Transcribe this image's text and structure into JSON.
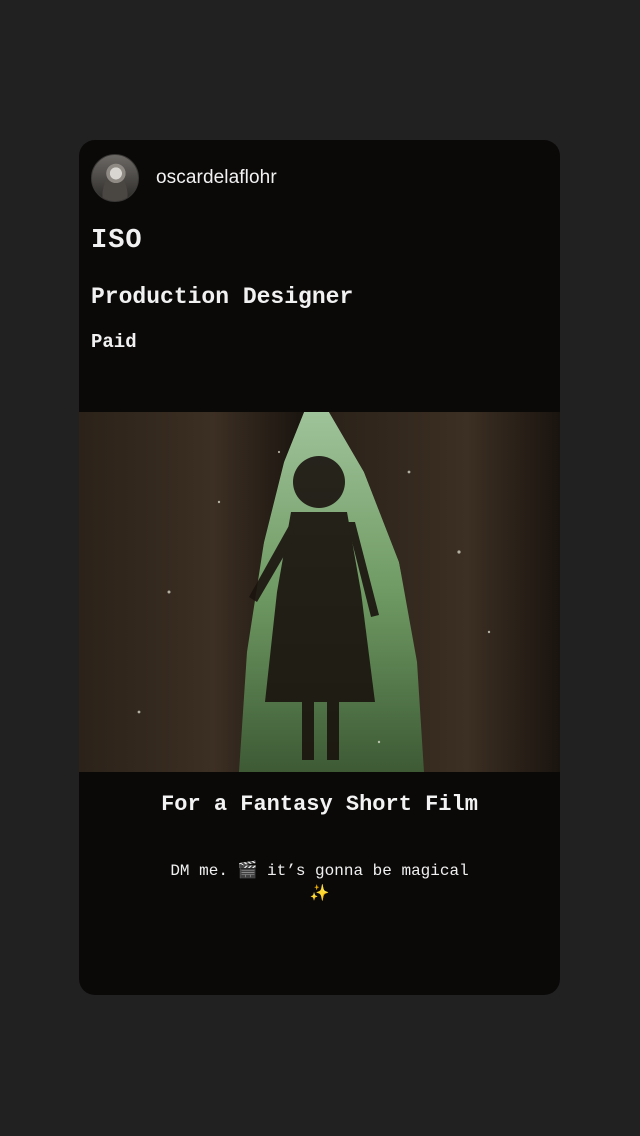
{
  "story": {
    "username": "oscardelaflohr",
    "avatar_icon": "profile-photo-icon",
    "headline": "ISO",
    "role": "Production Designer",
    "pay": "Paid",
    "tagline": "For a Fantasy Short Film",
    "note": "DM me. 🎬 it’s gonna be magical ✨",
    "image_subject": "girl-in-forest-tree-hollow-photo"
  },
  "colors": {
    "page_background": "#212121",
    "card_background": "#0b0908",
    "text": "#f1f1f1"
  }
}
